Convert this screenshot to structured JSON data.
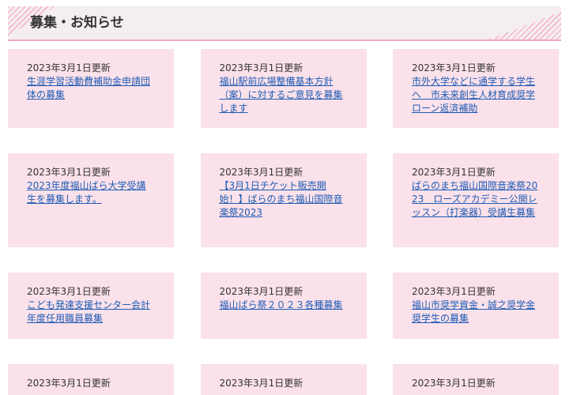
{
  "section": {
    "title": "募集・お知らせ"
  },
  "colors": {
    "header_bg": "#f5eef1",
    "header_stripe": "#f6b8cb",
    "header_border": "#f2a7bf",
    "card_bg": "#fbe1ea",
    "link": "#1f5cb5",
    "text": "#333333",
    "page_bg": "#ffffff"
  },
  "cards": [
    {
      "date": "2023年3月1日更新",
      "title": "生涯学習活動費補助金申請団体の募集"
    },
    {
      "date": "2023年3月1日更新",
      "title": "福山駅前広場整備基本方針（案）に対するご意見を募集します"
    },
    {
      "date": "2023年3月1日更新",
      "title": "市外大学などに通学する学生へ　市未来創生人材育成奨学ローン返済補助"
    },
    {
      "date": "2023年3月1日更新",
      "title": "2023年度福山ばら大学受講生を募集します。"
    },
    {
      "date": "2023年3月1日更新",
      "title": "【3月1日チケット販売開始！】ばらのまち福山国際音楽祭2023"
    },
    {
      "date": "2023年3月1日更新",
      "title": "ばらのまち福山国際音楽祭2023　ローズアカデミー公開レッスン（打楽器）受講生募集"
    },
    {
      "date": "2023年3月1日更新",
      "title": "こども発達支援センター会計年度任用職員募集"
    },
    {
      "date": "2023年3月1日更新",
      "title": "福山ばら祭２０２３各種募集"
    },
    {
      "date": "2023年3月1日更新",
      "title": "福山市奨学資金・誠之奨学金奨学生の募集"
    },
    {
      "date": "2023年3月1日更新"
    },
    {
      "date": "2023年3月1日更新"
    },
    {
      "date": "2023年3月1日更新"
    }
  ]
}
